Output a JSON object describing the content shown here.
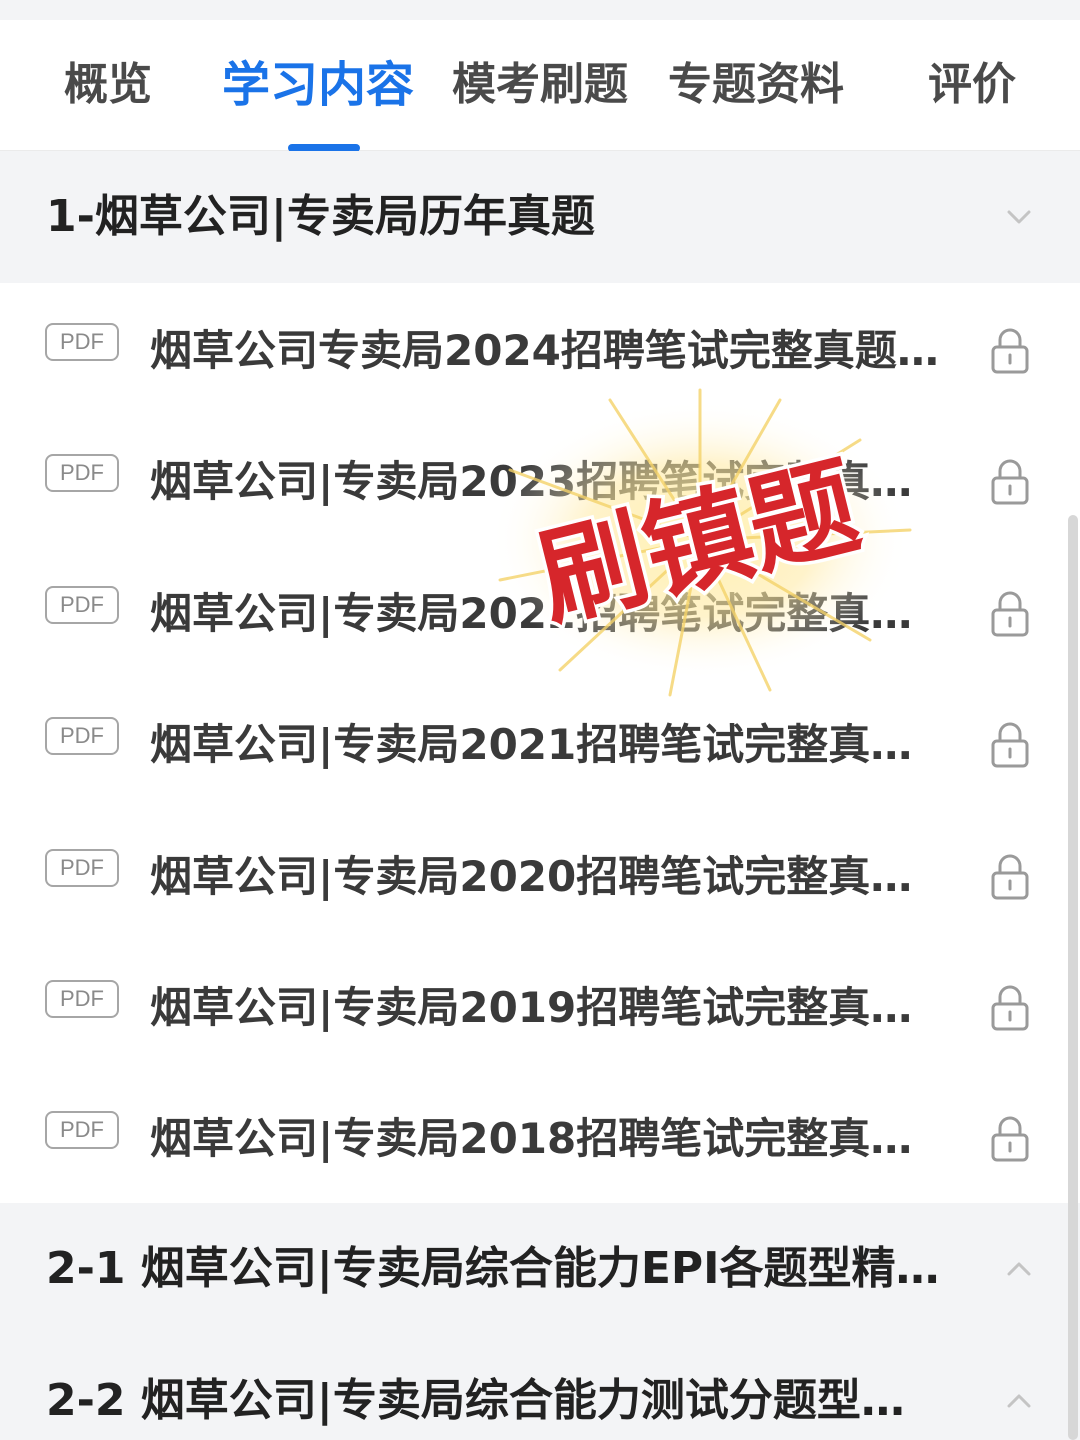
{
  "tabs": [
    {
      "label": "概览"
    },
    {
      "label": "学习内容"
    },
    {
      "label": "模考刷题"
    },
    {
      "label": "专题资料"
    },
    {
      "label": "评价"
    }
  ],
  "active_tab": "学习内容",
  "colors": {
    "accent": "#1a73e8",
    "section_bg": "#f3f4f6",
    "text": "#3a3a3a",
    "sticker_red": "#d6262b"
  },
  "sections": [
    {
      "title": "1-烟草公司|专卖局历年真题",
      "state": "expanded",
      "chevron": "chevron-down-icon",
      "items": [
        {
          "badge": "PDF",
          "title": "烟草公司专卖局2024招聘笔试完整真题…",
          "icon": "lock-icon"
        },
        {
          "badge": "PDF",
          "title": "烟草公司|专卖局2023招聘笔试完整真…",
          "icon": "lock-icon"
        },
        {
          "badge": "PDF",
          "title": "烟草公司|专卖局2022招聘笔试完整真…",
          "icon": "lock-icon"
        },
        {
          "badge": "PDF",
          "title": "烟草公司|专卖局2021招聘笔试完整真…",
          "icon": "lock-icon"
        },
        {
          "badge": "PDF",
          "title": "烟草公司|专卖局2020招聘笔试完整真…",
          "icon": "lock-icon"
        },
        {
          "badge": "PDF",
          "title": "烟草公司|专卖局2019招聘笔试完整真…",
          "icon": "lock-icon"
        },
        {
          "badge": "PDF",
          "title": "烟草公司|专卖局2018招聘笔试完整真…",
          "icon": "lock-icon"
        }
      ]
    },
    {
      "title": "2-1 烟草公司|专卖局综合能力EPI各题型精…",
      "state": "collapsed",
      "chevron": "chevron-up-icon"
    },
    {
      "title": "2-2 烟草公司|专卖局综合能力测试分题型…",
      "state": "collapsed",
      "chevron": "chevron-up-icon"
    }
  ],
  "sticker": {
    "text": "刷镇题"
  }
}
